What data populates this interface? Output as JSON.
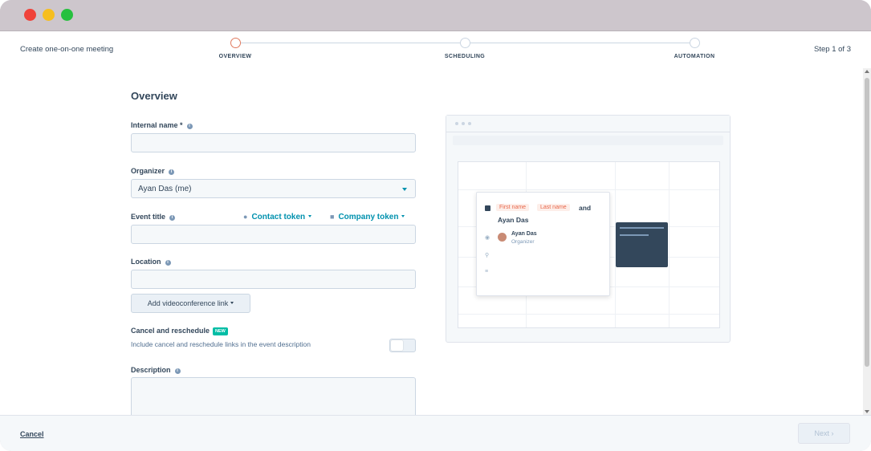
{
  "header": {
    "title": "Create one-on-one meeting",
    "step_indicator": "Step 1 of 3",
    "steps": [
      {
        "label": "OVERVIEW",
        "active": true
      },
      {
        "label": "SCHEDULING",
        "active": false
      },
      {
        "label": "AUTOMATION",
        "active": false
      }
    ]
  },
  "form": {
    "heading": "Overview",
    "internal_name": {
      "label": "Internal name *",
      "value": ""
    },
    "organizer": {
      "label": "Organizer",
      "value": "Ayan Das (me)"
    },
    "event_title": {
      "label": "Event title",
      "value": "",
      "contact_token": "Contact token",
      "company_token": "Company token"
    },
    "location": {
      "label": "Location",
      "value": "",
      "videoconference_button": "Add videoconference link"
    },
    "cancel_reschedule": {
      "label": "Cancel and reschedule",
      "badge": "NEW",
      "help": "Include cancel and reschedule links in the event description",
      "enabled": false
    },
    "description": {
      "label": "Description",
      "value": ""
    }
  },
  "preview": {
    "token_first": "First name",
    "token_last": "Last name",
    "and_text": "and",
    "attendee_name": "Ayan Das",
    "person_name": "Ayan Das",
    "person_role": "Organizer"
  },
  "footer": {
    "cancel_label": "Cancel",
    "next_label": "Next"
  },
  "colors": {
    "accent": "#0091ae",
    "active_step": "#e07a5f",
    "new_badge": "#00bda5",
    "token_text": "#e8674b",
    "dark_event": "#33475b"
  },
  "icons": [
    "info-icon",
    "person-icon",
    "building-icon",
    "caret-down-icon",
    "chevron-right-icon",
    "location-pin-icon",
    "text-lines-icon",
    "eye-icon"
  ]
}
